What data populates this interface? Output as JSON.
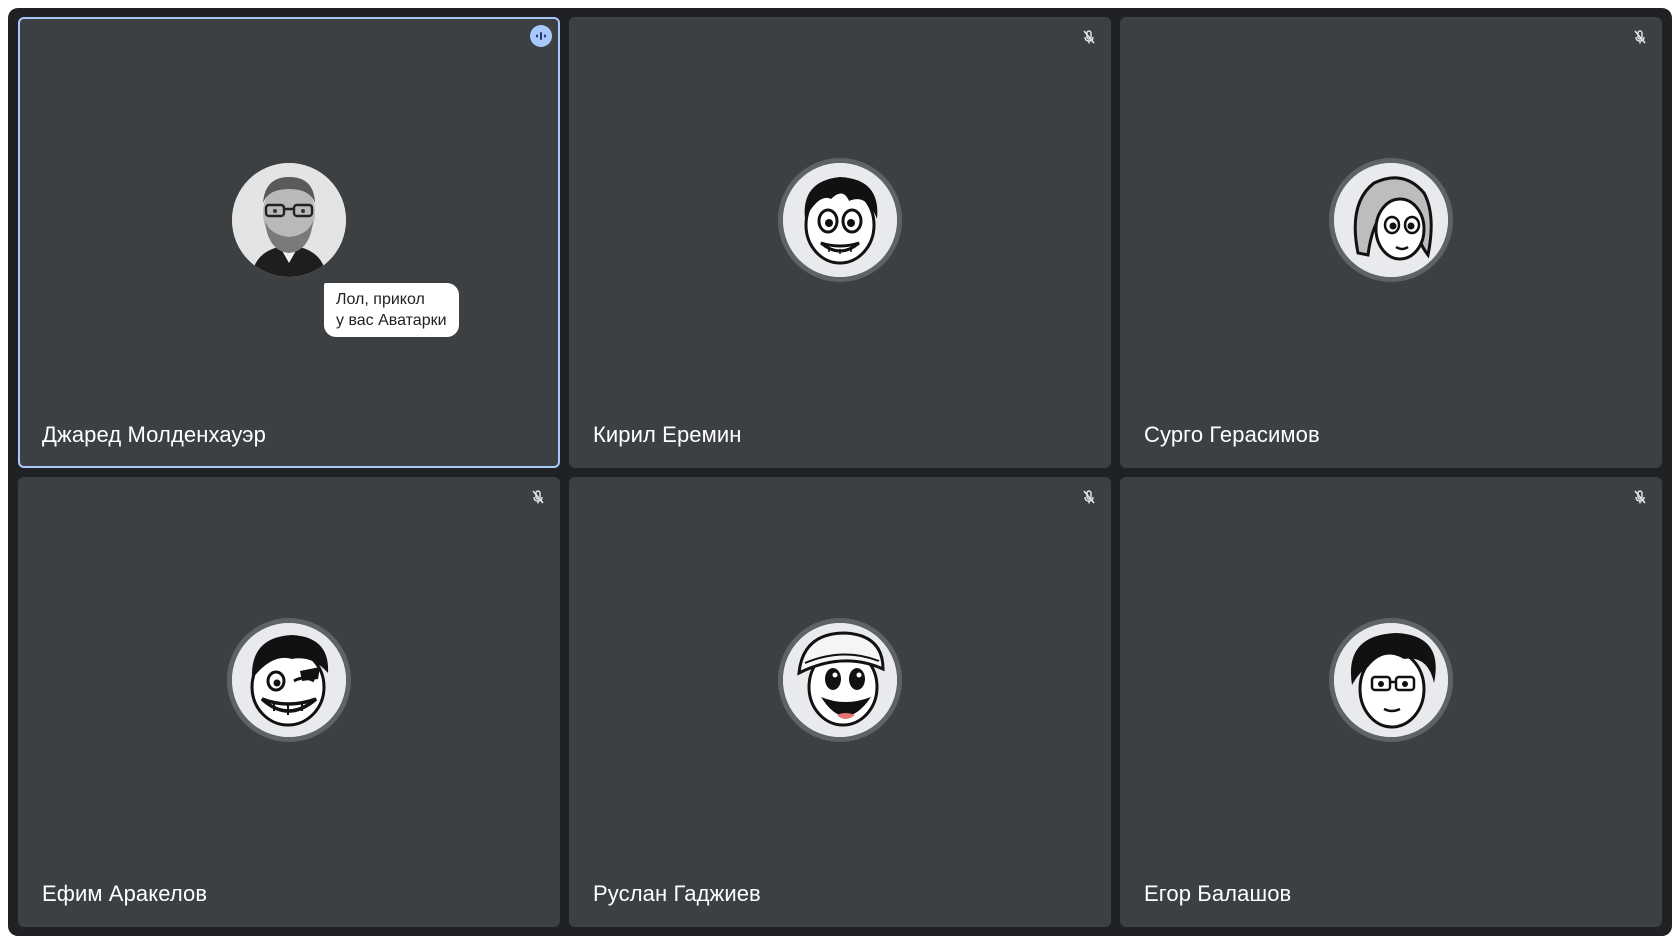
{
  "participants": [
    {
      "name": "Джаред Молденхауэр",
      "active": true,
      "status_icon": "speaking-indicator-icon",
      "bubble": "Лол, прикол\nу вас Аватарки",
      "avatar": "photo-man-glasses-beard"
    },
    {
      "name": "Кирил Еремин",
      "active": false,
      "status_icon": "mic-off-icon",
      "avatar": "cartoon-grinning-boy"
    },
    {
      "name": "Сурго Герасимов",
      "active": false,
      "status_icon": "mic-off-icon",
      "avatar": "cartoon-girl-light-hair"
    },
    {
      "name": "Ефим Аракелов",
      "active": false,
      "status_icon": "mic-off-icon",
      "avatar": "cartoon-laughing-man"
    },
    {
      "name": "Руслан Гаджиев",
      "active": false,
      "status_icon": "mic-off-icon",
      "avatar": "cartoon-beanie-man"
    },
    {
      "name": "Егор Балашов",
      "active": false,
      "status_icon": "mic-off-icon",
      "avatar": "cartoon-glasses-man"
    }
  ],
  "colors": {
    "background": "#202124",
    "tile": "#3c4043",
    "active_border": "#a8c7fa",
    "text": "#ffffff"
  }
}
